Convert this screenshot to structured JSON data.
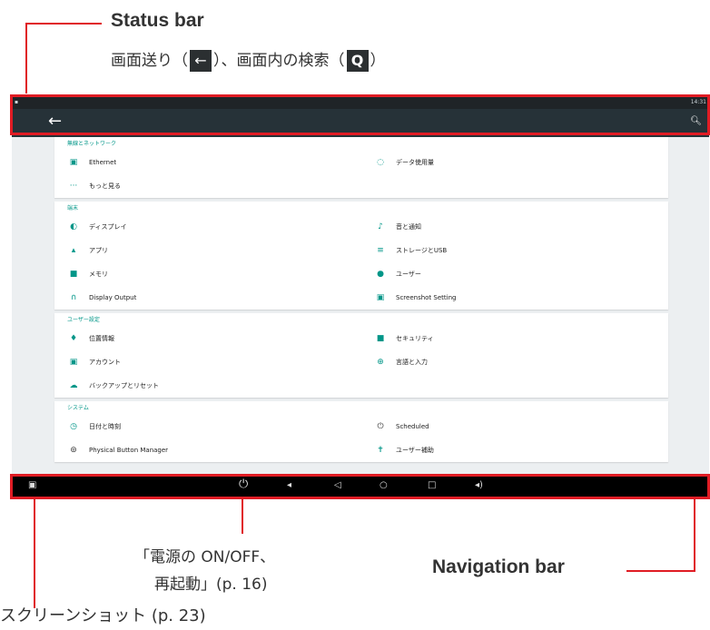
{
  "annotations": {
    "status_bar": "Status bar",
    "status_desc_pre": "画面送り（",
    "back_glyph": "←",
    "status_desc_mid": "）、画面内の検索（",
    "search_glyph": "Q",
    "status_desc_post": "）",
    "navigation_bar": "Navigation bar",
    "power_line1": "「電源の ON/OFF、",
    "power_line2": "再起動」(p. 16)",
    "screenshot": "スクリーンショット (p. 23)"
  },
  "status": {
    "time": "14:31"
  },
  "appbar": {
    "back_icon": "arrow-back-icon",
    "search_icon": "search-icon"
  },
  "sections": [
    {
      "header": "無線とネットワーク",
      "items": [
        {
          "label": "Ethernet",
          "icon": "ethernet-icon"
        },
        {
          "label": "データ使用量",
          "icon": "data-usage-icon"
        },
        {
          "label": "もっと見る",
          "icon": "more-icon"
        }
      ]
    },
    {
      "header": "端末",
      "items": [
        {
          "label": "ディスプレイ",
          "icon": "display-icon"
        },
        {
          "label": "音と通知",
          "icon": "bell-icon"
        },
        {
          "label": "アプリ",
          "icon": "android-icon"
        },
        {
          "label": "ストレージとUSB",
          "icon": "storage-icon"
        },
        {
          "label": "メモリ",
          "icon": "memory-icon"
        },
        {
          "label": "ユーザー",
          "icon": "user-icon"
        },
        {
          "label": "Display Output",
          "icon": "display-output-icon"
        },
        {
          "label": "Screenshot Setting",
          "icon": "screenshot-icon"
        }
      ]
    },
    {
      "header": "ユーザー設定",
      "items": [
        {
          "label": "位置情報",
          "icon": "location-icon"
        },
        {
          "label": "セキュリティ",
          "icon": "lock-icon"
        },
        {
          "label": "アカウント",
          "icon": "account-icon"
        },
        {
          "label": "言語と入力",
          "icon": "globe-icon"
        },
        {
          "label": "バックアップとリセット",
          "icon": "cloud-icon"
        }
      ]
    },
    {
      "header": "システム",
      "items": [
        {
          "label": "日付と時刻",
          "icon": "clock-icon"
        },
        {
          "label": "Scheduled",
          "icon": "power-icon"
        },
        {
          "label": "Physical Button Manager",
          "icon": "button-icon"
        },
        {
          "label": "ユーザー補助",
          "icon": "accessibility-icon"
        }
      ]
    }
  ],
  "navbar": {
    "icons": [
      "screenshot-icon",
      "power-icon",
      "volume-down-icon",
      "back-icon",
      "home-icon",
      "recents-icon",
      "volume-up-icon"
    ]
  },
  "colors": {
    "accent": "#009688",
    "annotation_red": "#e01c24",
    "appbar": "#263238"
  }
}
